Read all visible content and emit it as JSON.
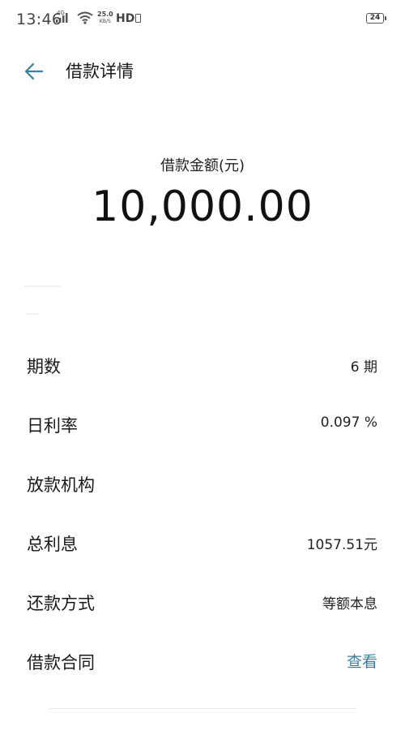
{
  "status_bar": {
    "time": "13:46",
    "network": "4G",
    "speed_value": "25.0",
    "speed_unit": "KB/S",
    "hd": "HD",
    "battery": "24"
  },
  "header": {
    "title": "借款详情"
  },
  "amount": {
    "label": "借款金额(元)",
    "value": "10,000.00"
  },
  "details": [
    {
      "label": "期数",
      "value": "6 期"
    },
    {
      "label": "日利率",
      "value": "0.097 %"
    },
    {
      "label": "放款机构",
      "value": ""
    },
    {
      "label": "总利息",
      "value": "1057.51元"
    },
    {
      "label": "还款方式",
      "value": "等额本息"
    },
    {
      "label": "借款合同",
      "value": "查看"
    }
  ],
  "colors": {
    "accent": "#3b7fa1",
    "text": "#1a1a1a",
    "background": "#ffffff"
  },
  "icons": {
    "back": "arrow-left-icon",
    "signal": "signal-icon",
    "wifi": "wifi-icon",
    "battery": "battery-icon"
  }
}
